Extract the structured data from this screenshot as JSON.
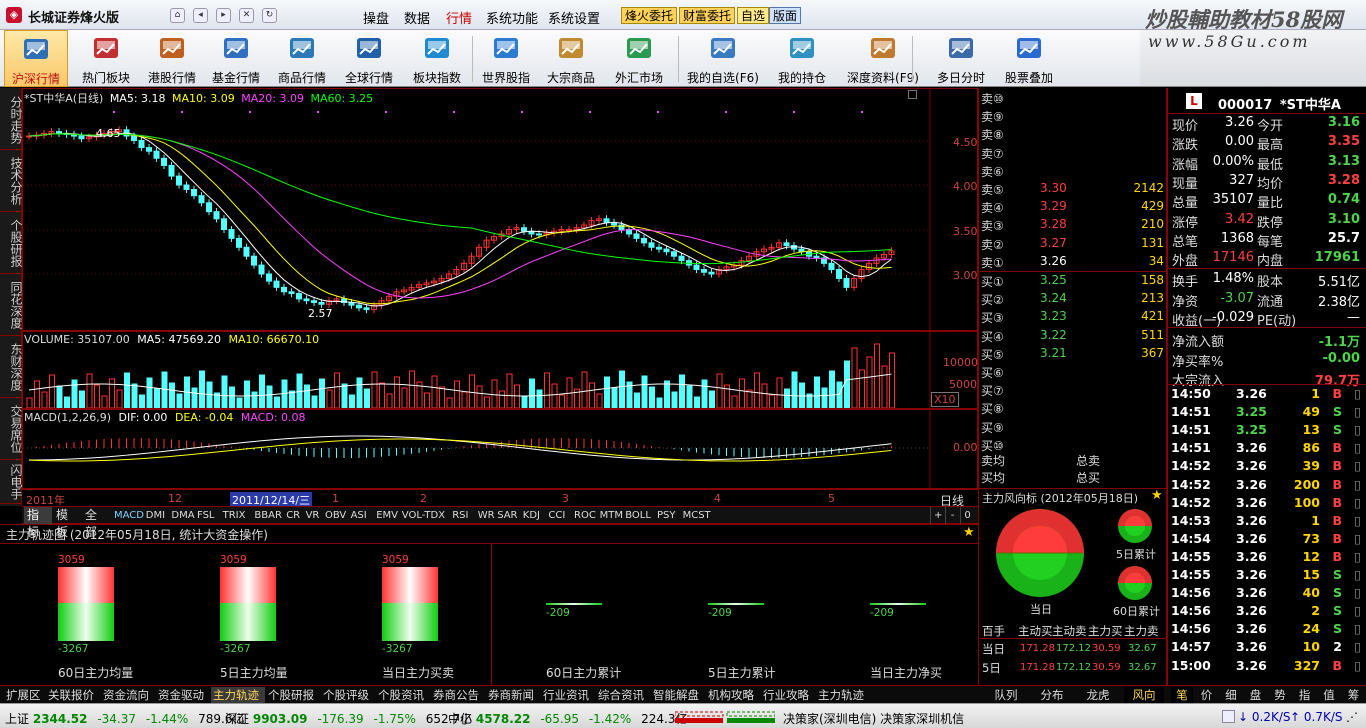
{
  "window": {
    "app_title": "长城证券烽火版",
    "logo": "L",
    "brand": "炒股輔助教材58股网",
    "brand_url": "www.58Gu.com"
  },
  "menu": {
    "items": [
      "操盘",
      "数据",
      "行情",
      "系统功能",
      "系统设置"
    ],
    "active": "行情",
    "tags": [
      "烽火委托",
      "财富委托",
      "自选",
      "版面"
    ]
  },
  "toolbar": [
    {
      "label": "沪深行情",
      "icon": "market-icon",
      "active": true
    },
    {
      "label": "热门板块",
      "icon": "hot-sector-icon"
    },
    {
      "label": "港股行情",
      "icon": "hk-stock-icon"
    },
    {
      "label": "基金行情",
      "icon": "fund-icon"
    },
    {
      "label": "商品行情",
      "icon": "commodity-icon"
    },
    {
      "label": "全球行情",
      "icon": "global-icon"
    },
    {
      "label": "板块指数",
      "icon": "sector-index-icon"
    },
    {
      "label": "世界股指",
      "icon": "world-index-icon"
    },
    {
      "label": "大宗商品",
      "icon": "bulk-commodity-icon"
    },
    {
      "label": "外汇市场",
      "icon": "forex-icon"
    },
    {
      "label": "我的自选(F6)",
      "icon": "my-watchlist-icon"
    },
    {
      "label": "我的持仓",
      "icon": "my-position-icon"
    },
    {
      "label": "深度资料(F9)",
      "icon": "deep-data-icon"
    },
    {
      "label": "多日分时",
      "icon": "multi-day-icon"
    },
    {
      "label": "股票叠加",
      "icon": "overlay-icon"
    }
  ],
  "left_tabs": [
    "分时走势",
    "技术分析",
    "个股研报",
    "同花深度",
    "东财深度",
    "交易席位",
    "闪电手"
  ],
  "kline": {
    "header": {
      "name": "*ST中华A(日线)",
      "ma5": "MA5: 3.18",
      "ma10": "MA10: 3.09",
      "ma20": "MA20: 3.09",
      "ma60": "MA60: 3.25"
    },
    "y_ticks": [
      "4.50",
      "4.00",
      "3.50",
      "3.00"
    ],
    "high_label": "4.65",
    "low_label": "2.57",
    "colors": {
      "up": "#ff3030",
      "down": "#54ffff",
      "ma5": "#ffffff",
      "ma10": "#ffff00",
      "ma20": "#ff40ff",
      "ma60": "#00ff00"
    }
  },
  "volume": {
    "header": {
      "title": "VOLUME: 35107.00",
      "ma5": "MA5: 47569.20",
      "ma10": "MA10: 66670.10"
    },
    "y_ticks": [
      "10000",
      "5000"
    ],
    "unit": "X10"
  },
  "macd": {
    "header": {
      "title": "MACD(1,2,26,9)",
      "dif": "DIF: 0.00",
      "dea": "DEA: -0.04",
      "macd": "MACD: 0.08"
    },
    "y_tick": "0.00"
  },
  "x_axis": {
    "labels": [
      "2011年",
      "12",
      "2011/12/14/三",
      "1",
      "2",
      "3",
      "4",
      "5"
    ],
    "period": "日线"
  },
  "indicator_tabs": [
    "指标",
    "模板",
    "全部",
    "MACD",
    "DMI",
    "DMA",
    "FSL",
    "TRIX",
    "BBAR",
    "CR",
    "VR",
    "OBV",
    "ASI",
    "EMV",
    "VOL-TDX",
    "RSI",
    "WR",
    "SAR",
    "KDJ",
    "CCI",
    "ROC",
    "MTM",
    "BOLL",
    "PSY",
    "MCST"
  ],
  "indicator_controls": [
    "+",
    "-",
    "0"
  ],
  "order_book": {
    "sells": [
      {
        "label": "卖⑩",
        "price": "",
        "vol": ""
      },
      {
        "label": "卖⑨",
        "price": "",
        "vol": ""
      },
      {
        "label": "卖⑧",
        "price": "",
        "vol": ""
      },
      {
        "label": "卖⑦",
        "price": "",
        "vol": ""
      },
      {
        "label": "卖⑥",
        "price": "",
        "vol": ""
      },
      {
        "label": "卖⑤",
        "price": "3.30",
        "vol": "2142"
      },
      {
        "label": "卖④",
        "price": "3.29",
        "vol": "429"
      },
      {
        "label": "卖③",
        "price": "3.28",
        "vol": "210"
      },
      {
        "label": "卖②",
        "price": "3.27",
        "vol": "131"
      },
      {
        "label": "卖①",
        "price": "3.26",
        "vol": "34"
      }
    ],
    "buys": [
      {
        "label": "买①",
        "price": "3.25",
        "vol": "158"
      },
      {
        "label": "买②",
        "price": "3.24",
        "vol": "213"
      },
      {
        "label": "买③",
        "price": "3.23",
        "vol": "421"
      },
      {
        "label": "买④",
        "price": "3.22",
        "vol": "511"
      },
      {
        "label": "买⑤",
        "price": "3.21",
        "vol": "367"
      },
      {
        "label": "买⑥",
        "price": "",
        "vol": ""
      },
      {
        "label": "买⑦",
        "price": "",
        "vol": ""
      },
      {
        "label": "买⑧",
        "price": "",
        "vol": ""
      },
      {
        "label": "买⑨",
        "price": "",
        "vol": ""
      },
      {
        "label": "买⑩",
        "price": "",
        "vol": ""
      }
    ],
    "avg_sell": "卖均",
    "avg_buy": "买均",
    "total_sell": "总卖",
    "total_buy": "总买"
  },
  "main_force_wind": {
    "title": "主力风向标 (2012年05月18日)",
    "today": "当日",
    "d5": "5日累计",
    "d60": "60日累计",
    "table": {
      "headers": [
        "百手",
        "主动买",
        "主动卖",
        "主力买",
        "主力卖"
      ],
      "rows": [
        {
          "label": "当日",
          "values": [
            "171.28",
            "172.12",
            "30.59",
            "32.67"
          ]
        },
        {
          "label": "5日",
          "values": [
            "171.28",
            "172.12",
            "30.59",
            "32.67"
          ]
        }
      ]
    }
  },
  "main_force_track": {
    "title": "主力轨迹图 (2012年05月18日, 统计大资金操作)",
    "bars": [
      {
        "top": "3059",
        "bottom": "-3267",
        "label": "60日主力均量",
        "red": 3059,
        "green": 3267
      },
      {
        "top": "3059",
        "bottom": "-3267",
        "label": "5日主力均量",
        "red": 3059,
        "green": 3267
      },
      {
        "top": "3059",
        "bottom": "-3267",
        "label": "当日主力买卖",
        "red": 3059,
        "green": 3267
      },
      {
        "top": "",
        "bottom": "-209",
        "label": "60日主力累计",
        "red": 0,
        "green": 209
      },
      {
        "top": "",
        "bottom": "-209",
        "label": "5日主力累计",
        "red": 0,
        "green": 209
      },
      {
        "top": "",
        "bottom": "-209",
        "label": "当日主力净买",
        "red": 0,
        "green": 209
      }
    ]
  },
  "bottom_tabs": [
    "扩展区",
    "关联报价",
    "资金流向",
    "资金驱动",
    "主力轨迹",
    "个股研报",
    "个股评级",
    "个股资讯",
    "券商公告",
    "券商新闻",
    "行业资讯",
    "综合资讯",
    "智能解盘",
    "机构攻略",
    "行业攻略",
    "主力轨迹"
  ],
  "bottom_tab_active": "主力轨迹",
  "right_bottom_tabs": [
    "队列",
    "分布",
    "龙虎",
    "风向"
  ],
  "right_bottom_tab_active": "风向",
  "quote_tabs": [
    "笔",
    "价",
    "细",
    "盘",
    "势",
    "指",
    "值",
    "筹"
  ],
  "quote": {
    "code": "000017",
    "name": "*ST中华A",
    "rows": [
      [
        "现价",
        "3.26",
        "今开",
        "3.16"
      ],
      [
        "涨跌",
        "0.00",
        "最高",
        "3.35"
      ],
      [
        "涨幅",
        "0.00%",
        "最低",
        "3.13"
      ],
      [
        "现量",
        "327",
        "均价",
        "3.28"
      ],
      [
        "总量",
        "35107",
        "量比",
        "0.74"
      ],
      [
        "涨停",
        "3.42",
        "跌停",
        "3.10"
      ],
      [
        "总笔",
        "1368",
        "每笔",
        "25.7"
      ],
      [
        "外盘",
        "17146",
        "内盘",
        "17961"
      ],
      [
        "换手",
        "1.48%",
        "股本",
        "5.51亿"
      ],
      [
        "净资",
        "-3.07",
        "流通",
        "2.38亿"
      ],
      [
        "收益(一)",
        "-0.029",
        "PE(动)",
        "—"
      ],
      [
        "净流入额",
        "",
        "",
        "-1.1万"
      ],
      [
        "净买率%",
        "",
        "",
        "-0.00"
      ],
      [
        "大宗流入",
        "",
        "",
        "79.7万"
      ]
    ]
  },
  "ticks": [
    {
      "t": "14:50",
      "p": "3.26",
      "v": "1",
      "bs": "B"
    },
    {
      "t": "14:51",
      "p": "3.25",
      "v": "49",
      "bs": "S"
    },
    {
      "t": "14:51",
      "p": "3.25",
      "v": "13",
      "bs": "S"
    },
    {
      "t": "14:51",
      "p": "3.26",
      "v": "86",
      "bs": "B"
    },
    {
      "t": "14:52",
      "p": "3.26",
      "v": "39",
      "bs": "B"
    },
    {
      "t": "14:52",
      "p": "3.26",
      "v": "200",
      "bs": "B"
    },
    {
      "t": "14:52",
      "p": "3.26",
      "v": "100",
      "bs": "B"
    },
    {
      "t": "14:53",
      "p": "3.26",
      "v": "1",
      "bs": "B"
    },
    {
      "t": "14:54",
      "p": "3.26",
      "v": "73",
      "bs": "B"
    },
    {
      "t": "14:55",
      "p": "3.26",
      "v": "12",
      "bs": "B"
    },
    {
      "t": "14:55",
      "p": "3.26",
      "v": "15",
      "bs": "S"
    },
    {
      "t": "14:56",
      "p": "3.26",
      "v": "40",
      "bs": "S"
    },
    {
      "t": "14:56",
      "p": "3.26",
      "v": "2",
      "bs": "S"
    },
    {
      "t": "14:56",
      "p": "3.26",
      "v": "24",
      "bs": "S"
    },
    {
      "t": "14:57",
      "p": "3.26",
      "v": "10",
      "bs": "2"
    },
    {
      "t": "15:00",
      "p": "3.26",
      "v": "327",
      "bs": "B"
    }
  ],
  "status": {
    "sh": "上证",
    "sh_val": "2344.52",
    "sh_chg": "-34.37",
    "sh_pct": "-1.44%",
    "sh_amt": "789.6亿",
    "sz": "深证",
    "sz_val": "9903.09",
    "sz_chg": "-176.39",
    "sz_pct": "-1.75%",
    "sz_amt": "652.7亿",
    "zx": "中小",
    "zx_val": "4578.22",
    "zx_chg": "-65.95",
    "zx_pct": "-1.42%",
    "zx_amt": "224.3亿",
    "ticker": "决策家(深圳电信) 决策家深圳机信",
    "down_speed": "0.2K/S",
    "up_speed": "0.7K/S"
  }
}
